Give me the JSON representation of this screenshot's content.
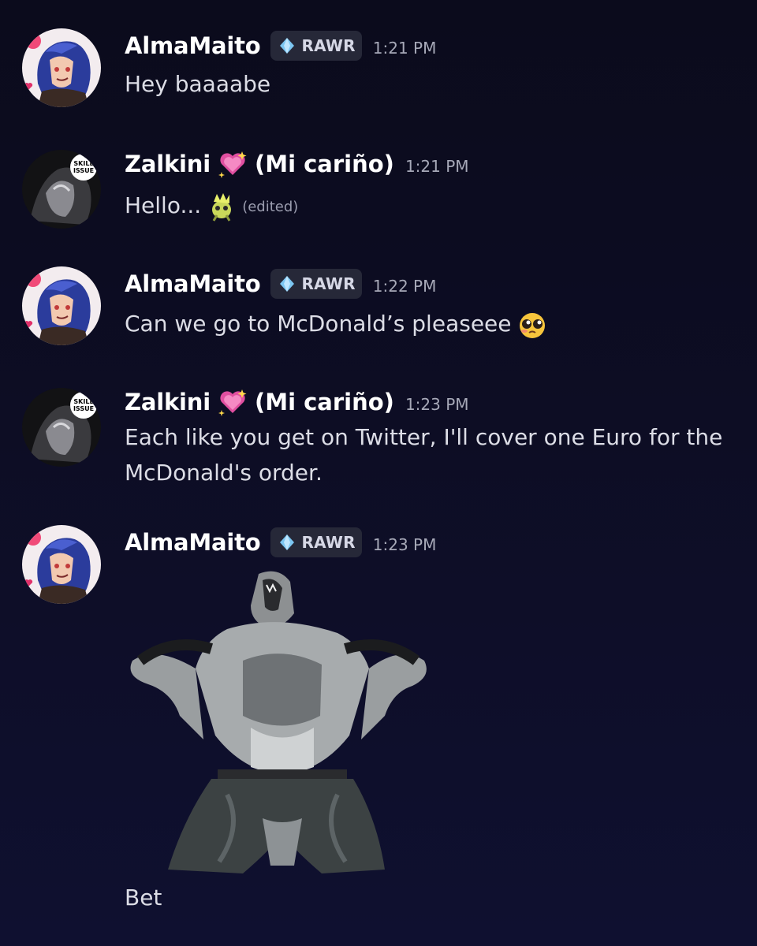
{
  "messages": [
    {
      "username": "AlmaMaito",
      "tag": "RAWR",
      "time": "1:21 PM",
      "text": "Hey baaaabe"
    },
    {
      "username": "Zalkini",
      "nickname": "(Mi cariño)",
      "time": "1:21 PM",
      "text": "Hello...",
      "edited": "(edited)"
    },
    {
      "username": "AlmaMaito",
      "tag": "RAWR",
      "time": "1:22 PM",
      "text": "Can we go to McDonald’s pleaseee"
    },
    {
      "username": "Zalkini",
      "nickname": "(Mi cariño)",
      "time": "1:23 PM",
      "text": "Each like you get on Twitter, I'll cover one Euro for the McDonald's order."
    },
    {
      "username": "AlmaMaito",
      "tag": "RAWR",
      "time": "1:23 PM",
      "text": "Bet"
    }
  ],
  "avatar_badges": {
    "skill_issue_line1": "SKILL",
    "skill_issue_line2": "ISSUE"
  },
  "colors": {
    "background": "#0d0d24",
    "tag_background": "#262838",
    "tag_gem": "#7cc6f2",
    "heart_emoji": "#e04fa0"
  },
  "icons": {
    "tag": "gem-icon",
    "nickname_emoji": "sparkling-heart-icon",
    "hello_emoji": "yellow-creature-emoji",
    "please_emoji": "pleading-face-emoji",
    "sticker": "werewolf-sticker"
  }
}
